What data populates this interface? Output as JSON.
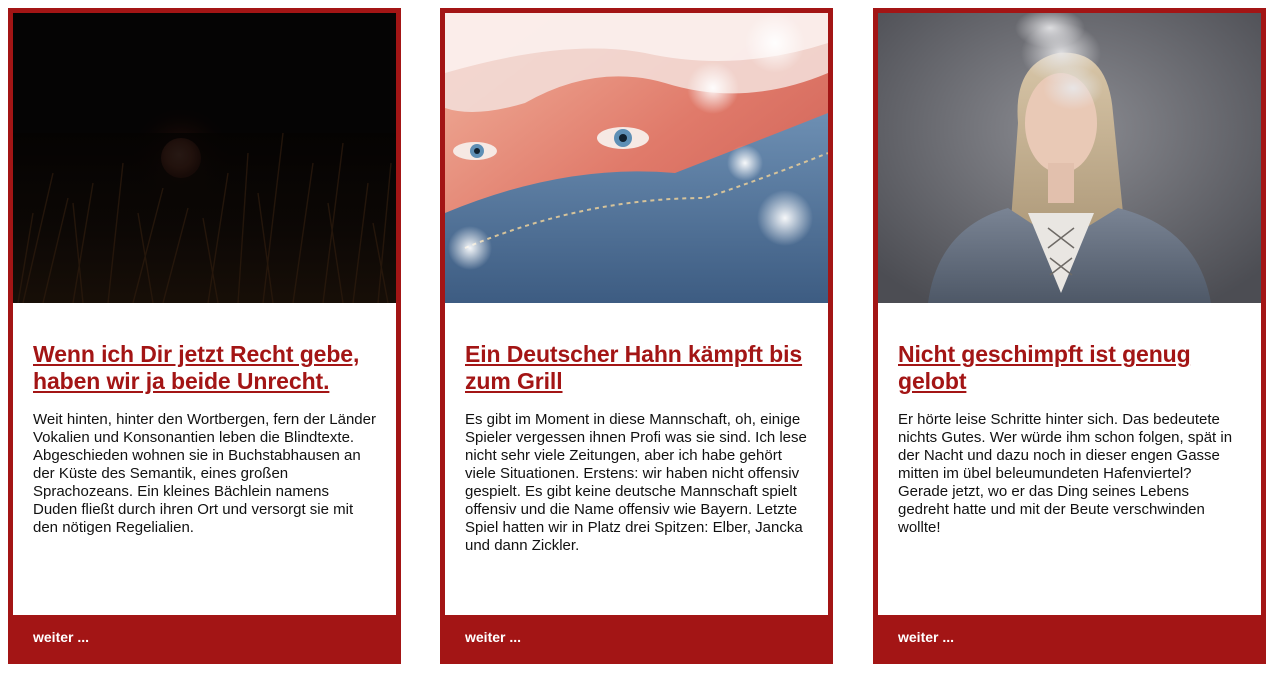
{
  "cards": [
    {
      "image": "red-moon-night-photo",
      "title": "Wenn ich Dir jetzt Recht gebe, haben wir ja beide Unrecht.",
      "text": "Weit hinten, hinter den Wortbergen, fern der Länder Vokalien und Konsonantien leben die Blindtexte. Abgeschieden wohnen sie in Buchstabhausen an der Küste des Semantik, eines großen Sprachozeans. Ein kleines Bächlein namens Duden fließt durch ihren Ort und versorgt sie mit den nötigen Regelialien.",
      "link": "weiter ..."
    },
    {
      "image": "woman-eyes-denim-collar-photo",
      "title": "Ein Deutscher Hahn kämpft bis zum Grill",
      "text": "Es gibt im Moment in diese Mannschaft, oh, einige Spieler vergessen ihnen Profi was sie sind. Ich lese nicht sehr viele Zeitungen, aber ich habe gehört viele Situationen. Erstens: wir haben nicht offensiv gespielt. Es gibt keine deutsche Mannschaft spielt offensiv und die Name offensiv wie Bayern. Letzte Spiel hatten wir in Platz drei Spitzen: Elber, Jancka und dann Zickler.",
      "link": "weiter ..."
    },
    {
      "image": "woman-exhaling-smoke-photo",
      "title": "Nicht geschimpft ist genug gelobt",
      "text": "Er hörte leise Schritte hinter sich. Das bedeutete nichts Gutes. Wer würde ihm schon folgen, spät in der Nacht und dazu noch in dieser engen Gasse mitten im übel beleumundeten Hafenviertel? Gerade jetzt, wo er das Ding seines Lebens gedreht hatte und mit der Beute verschwinden wollte!",
      "link": "weiter ..."
    }
  ],
  "colors": {
    "accent": "#a31515",
    "card_body": "#ffffff",
    "text": "#111111",
    "link": "#ffffff"
  }
}
